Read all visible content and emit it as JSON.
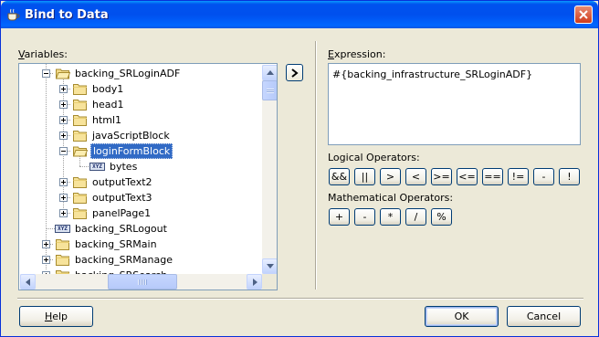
{
  "window": {
    "title": "Bind to Data"
  },
  "variables": {
    "label": "Variables:",
    "tree": [
      {
        "label": "backing_SRLoginADF",
        "kind": "folder",
        "expander": "minus"
      },
      {
        "label": "body1",
        "kind": "folder",
        "expander": "plus"
      },
      {
        "label": "head1",
        "kind": "folder",
        "expander": "plus"
      },
      {
        "label": "html1",
        "kind": "folder",
        "expander": "plus"
      },
      {
        "label": "javaScriptBlock",
        "kind": "folder",
        "expander": "plus"
      },
      {
        "label": "loginFormBlock",
        "kind": "folder",
        "expander": "minus",
        "selected": true
      },
      {
        "label": "bytes",
        "kind": "variable"
      },
      {
        "label": "outputText2",
        "kind": "folder",
        "expander": "plus"
      },
      {
        "label": "outputText3",
        "kind": "folder",
        "expander": "plus"
      },
      {
        "label": "panelPage1",
        "kind": "folder",
        "expander": "plus"
      },
      {
        "label": "backing_SRLogout",
        "kind": "variable"
      },
      {
        "label": "backing_SRMain",
        "kind": "folder",
        "expander": "plus"
      },
      {
        "label": "backing_SRManage",
        "kind": "folder",
        "expander": "plus"
      },
      {
        "label": "backing_SRSearch",
        "kind": "folder",
        "expander": "plus"
      }
    ],
    "var_icon_text": "XYZ"
  },
  "expression": {
    "label": "Expression:",
    "value": "#{backing_infrastructure_SRLoginADF}"
  },
  "logical_operators": {
    "label": "Logical Operators:",
    "buttons": [
      "&&",
      "||",
      ">",
      "<",
      ">=",
      "<=",
      "==",
      "!=",
      "-",
      "!"
    ]
  },
  "math_operators": {
    "label": "Mathematical Operators:",
    "buttons": [
      "+",
      "-",
      "*",
      "/",
      "%"
    ]
  },
  "footer": {
    "help": "Help",
    "ok": "OK",
    "cancel": "Cancel"
  },
  "icons": {
    "title": "coffee-cup-icon",
    "close": "close-icon",
    "add": "chevron-right-icon"
  },
  "colors": {
    "title_bar": "#0053ee",
    "selection": "#316ac5",
    "dialog_bg": "#ece9d8"
  }
}
